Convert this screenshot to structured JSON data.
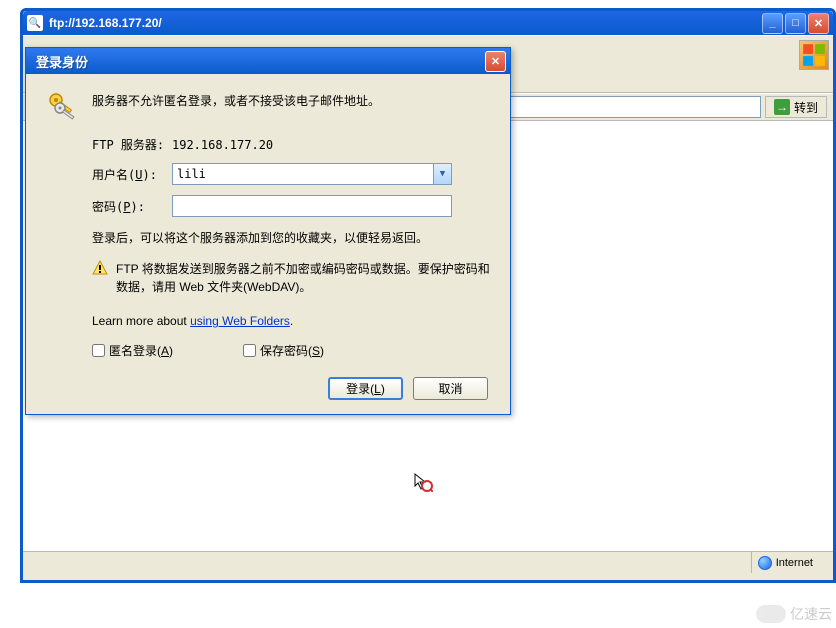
{
  "ie": {
    "title": "ftp://192.168.177.20/",
    "go_label": "转到",
    "status_right": "Internet"
  },
  "dialog": {
    "title": "登录身份",
    "message": "服务器不允许匿名登录，或者不接受该电子邮件地址。",
    "server_label": "FTP 服务器:",
    "server_value": "192.168.177.20",
    "user_label": "用户名(U):",
    "user_value": "lili",
    "pass_label": "密码(P):",
    "pass_value": "",
    "hint": "登录后，可以将这个服务器添加到您的收藏夹，以便轻易返回。",
    "warning": "FTP 将数据发送到服务器之前不加密或编码密码或数据。要保护密码和数据，请用 Web 文件夹(WebDAV)。",
    "learn_prefix": "Learn more about ",
    "learn_link": "using Web Folders",
    "anon_label": "匿名登录(A)",
    "save_label": "保存密码(S)",
    "login_btn": "登录(L)",
    "cancel_btn": "取消"
  },
  "watermark": "亿速云"
}
